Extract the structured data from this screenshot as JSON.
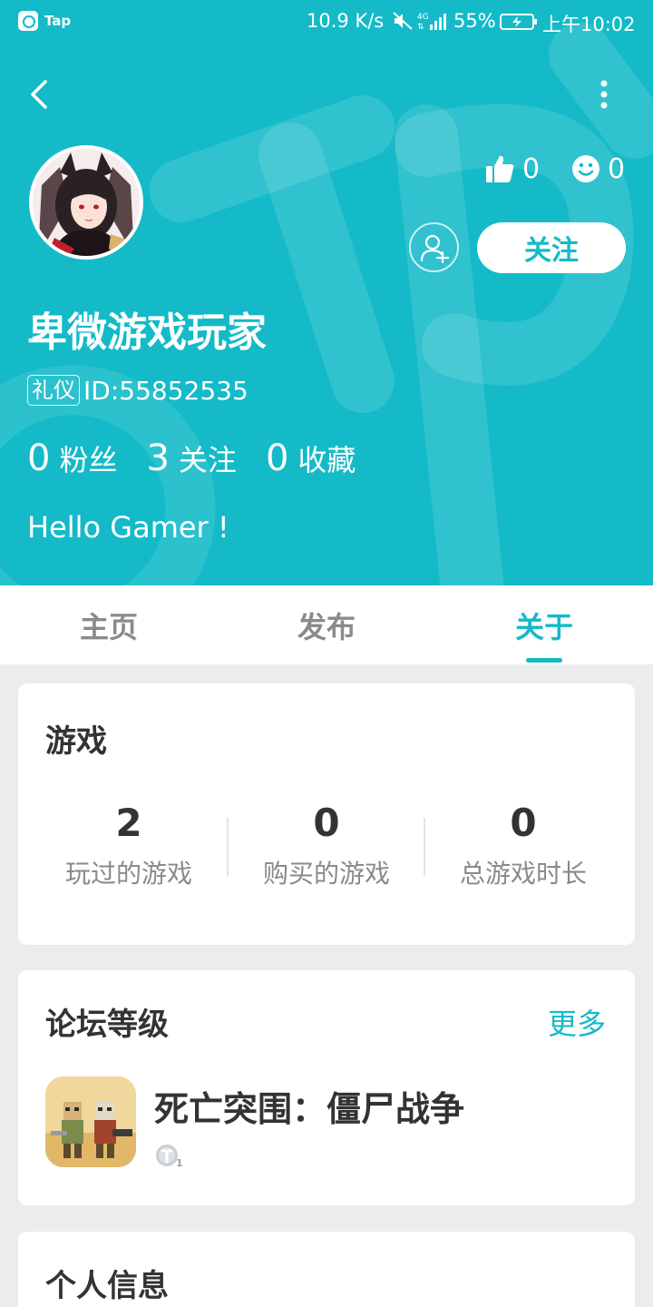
{
  "status_bar": {
    "app_name": "Tap",
    "net_speed": "10.9 K/s",
    "battery_percent": "55%",
    "time": "上午10:02"
  },
  "header": {
    "back_icon": "chevron-left-icon",
    "more_icon": "more-vertical-icon"
  },
  "profile": {
    "likes": "0",
    "smiles": "0",
    "follow_label": "关注",
    "username": "卑微游戏玩家",
    "id_badge": "礼仪",
    "id_text": "ID:55852535",
    "fans_count": "0",
    "fans_label": "粉丝",
    "following_count": "3",
    "following_label": "关注",
    "favorites_count": "0",
    "favorites_label": "收藏",
    "bio": "Hello Gamer !"
  },
  "tabs": [
    {
      "label": "主页"
    },
    {
      "label": "发布"
    },
    {
      "label": "关于"
    }
  ],
  "games": {
    "title": "游戏",
    "stats": [
      {
        "value": "2",
        "label": "玩过的游戏"
      },
      {
        "value": "0",
        "label": "购买的游戏"
      },
      {
        "value": "0",
        "label": "总游戏时长"
      }
    ]
  },
  "forum": {
    "title": "论坛等级",
    "more_label": "更多",
    "game_name": "死亡突围：僵尸战争",
    "level_badge": "T1"
  },
  "personal_info": {
    "title": "个人信息"
  },
  "colors": {
    "accent": "#14bac8",
    "text_dark": "#333333",
    "text_muted": "#8a8a8a"
  }
}
